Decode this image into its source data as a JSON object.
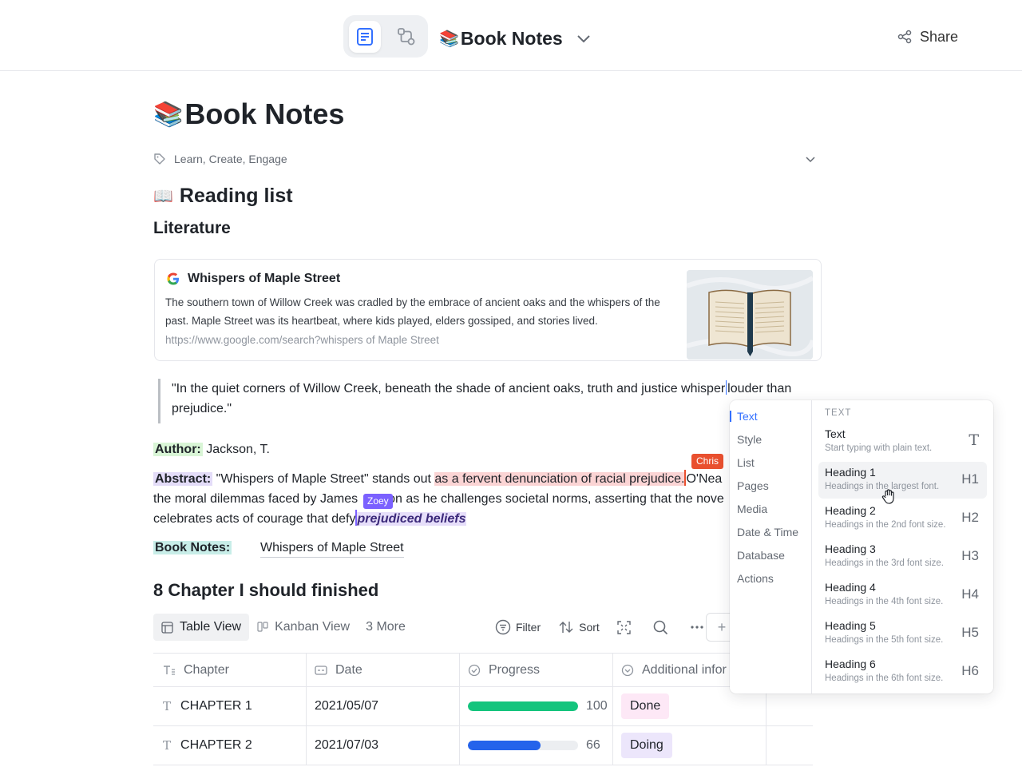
{
  "topbar": {
    "title_emoji": "📚",
    "title": "Book Notes",
    "share_label": "Share"
  },
  "doc": {
    "title_emoji": "📚",
    "title": "Book Notes",
    "tags": "Learn, Create, Engage",
    "reading_emoji": "📖",
    "reading_heading": "Reading list",
    "literature_heading": "Literature"
  },
  "card": {
    "title": "Whispers of Maple Street",
    "description": "The southern town of Willow Creek was cradled by the embrace of ancient oaks and the whispers of the past. Maple Street was its heartbeat, where kids played, elders gossiped, and stories lived.",
    "url": "https://www.google.com/search?whispers of Maple Street"
  },
  "quote": {
    "before_cursor": "\"In the quiet corners of Willow Creek, beneath the shade of ancient oaks, truth and justice whisper",
    "after_cursor": "louder than prejudice.\""
  },
  "author": {
    "label": "Author:",
    "value": " Jackson, T."
  },
  "abstract": {
    "label": "Abstract:",
    "line1_a": " \"Whispers of Maple Street\" stands out ",
    "line1_highlight": "as a fervent denunciation of racial prejudice.",
    "line1_b": "O'Nea",
    "line2_a": "the moral dilemmas faced by James",
    "line2_b": "on as he challenges societal norms, asserting that the nove",
    "line3_a": "celebrates acts of courage that defy",
    "line3_highlight": "prejudiced beliefs",
    "collaborator_1": "Chris",
    "collaborator_2": "Zoey"
  },
  "book_notes": {
    "label": "Book Notes:",
    "value": "Whispers of Maple Street"
  },
  "chapter_section": {
    "heading": "8 Chapter I should finished",
    "tabs": [
      "Table View",
      "Kanban View",
      "3 More"
    ],
    "filter_label": "Filter",
    "sort_label": "Sort",
    "plus_label": "+"
  },
  "table": {
    "headers": [
      "Chapter",
      "Date",
      "Progress",
      "Additional infor"
    ],
    "rows": [
      {
        "chapter": "CHAPTER 1",
        "date": "2021/05/07",
        "progress": 100,
        "progress_label": "100",
        "progress_color": "#14c47d",
        "status": "Done",
        "status_bg": "#fde8f6"
      },
      {
        "chapter": "CHAPTER 2",
        "date": "2021/07/03",
        "progress": 66,
        "progress_label": "66",
        "progress_color": "#2563eb",
        "status": "Doing",
        "status_bg": "#ece6fb"
      }
    ]
  },
  "menu": {
    "categories": [
      "Text",
      "Style",
      "List",
      "Pages",
      "Media",
      "Date & Time",
      "Database",
      "Actions"
    ],
    "section_title": "TEXT",
    "items": [
      {
        "title": "Text",
        "subtitle": "Start typing with plain text.",
        "key": "T"
      },
      {
        "title": "Heading 1",
        "subtitle": "Headings in the largest font.",
        "key": "H1"
      },
      {
        "title": "Heading 2",
        "subtitle": "Headings in the 2nd font size.",
        "key": "H2"
      },
      {
        "title": "Heading 3",
        "subtitle": "Headings in the 3rd font size.",
        "key": "H3"
      },
      {
        "title": "Heading 4",
        "subtitle": "Headings in the 4th font size.",
        "key": "H4"
      },
      {
        "title": "Heading 5",
        "subtitle": "Headings in the 5th font size.",
        "key": "H5"
      },
      {
        "title": "Heading 6",
        "subtitle": "Headings in the 6th font size.",
        "key": "H6"
      }
    ]
  },
  "colors": {
    "accent": "#3370ff",
    "chris": "#e9502f",
    "zoey": "#7b61ff"
  }
}
